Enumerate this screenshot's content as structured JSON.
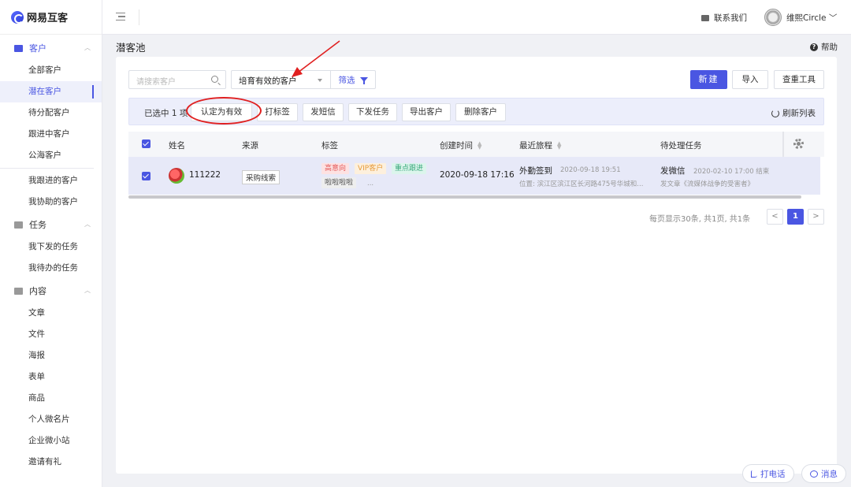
{
  "app": {
    "name": "网易互客"
  },
  "sidebar": {
    "groups": [
      {
        "label": "客户",
        "items": [
          "全部客户",
          "潜在客户",
          "待分配客户",
          "跟进中客户",
          "公海客户"
        ],
        "items2": [
          "我跟进的客户",
          "我协助的客户"
        ]
      },
      {
        "label": "任务",
        "items": [
          "我下发的任务",
          "我待办的任务"
        ]
      },
      {
        "label": "内容",
        "items": [
          "文章",
          "文件",
          "海报",
          "表单",
          "商品",
          "个人微名片",
          "企业微小站",
          "邀请有礼"
        ]
      }
    ]
  },
  "topbar": {
    "contact": "联系我们",
    "username": "维熙Circle"
  },
  "page": {
    "title": "潜客池",
    "help": "帮助"
  },
  "toolbar": {
    "search_placeholder": "请搜索客户",
    "select_value": "培育有效的客户",
    "filter": "筛选",
    "new": "新建",
    "import": "导入",
    "dedupe": "查重工具"
  },
  "batch": {
    "selected": "已选中 1 项",
    "buttons": [
      "认定为有效",
      "打标签",
      "发短信",
      "下发任务",
      "导出客户",
      "删除客户"
    ],
    "refresh": "刷新列表"
  },
  "table": {
    "headers": [
      "姓名",
      "来源",
      "标签",
      "创建时间",
      "最近旅程",
      "待处理任务"
    ],
    "row": {
      "name": "111222",
      "source": "采购线索",
      "tags": [
        "高意向",
        "VIP客户",
        "重点跟进",
        "啦啦啦啦",
        "..."
      ],
      "created": "2020-09-18 17:16",
      "journey_title": "外勤签到",
      "journey_time": "2020-09-18 19:51",
      "journey_location": "位置: 滨江区滨江区长河路475号华城和...",
      "task_title": "发微信",
      "task_time": "2020-02-10 17:00 结束",
      "task_detail": "发文章《流媒体战争的受害者》"
    }
  },
  "pagination": {
    "summary": "每页显示30条, 共1页, 共1条",
    "prev": "<",
    "current": "1",
    "next": ">"
  },
  "floating": {
    "call": "打电话",
    "message": "消息"
  },
  "colors": {
    "primary": "#4a56e2",
    "annotation": "#e02020"
  }
}
